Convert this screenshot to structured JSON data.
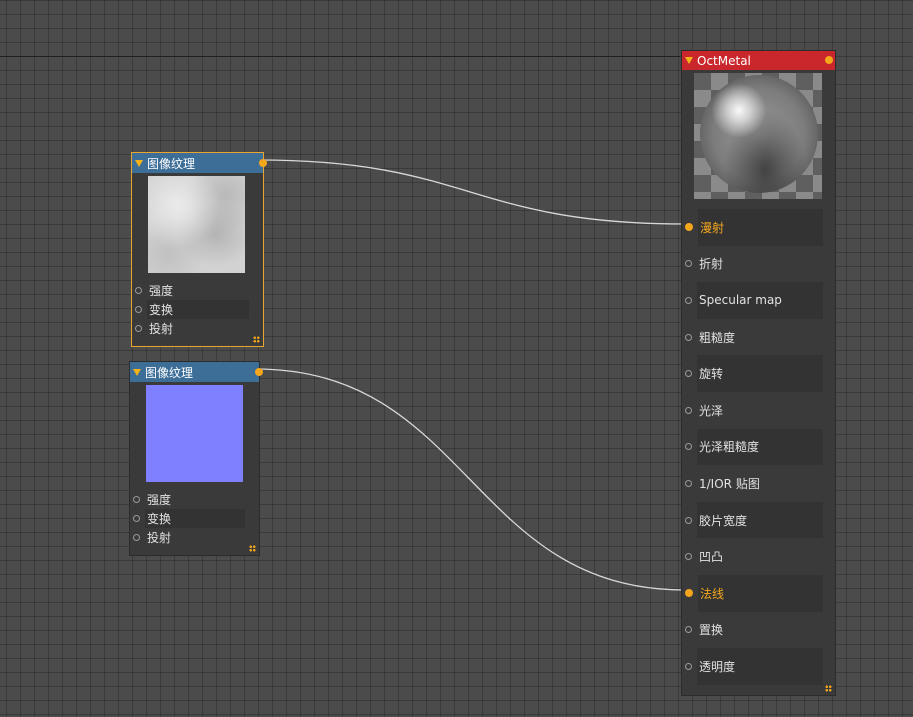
{
  "nodes": {
    "tex1": {
      "title": "图像纹理",
      "thumb_color": "#d8d8d8",
      "inputs": [
        "强度",
        "变换",
        "投射"
      ]
    },
    "tex2": {
      "title": "图像纹理",
      "thumb_color": "#7f80ff",
      "inputs": [
        "强度",
        "变换",
        "投射"
      ]
    },
    "octmetal": {
      "title": "OctMetal",
      "inputs": [
        {
          "label": "漫射",
          "connected": true
        },
        {
          "label": "折射",
          "connected": false
        },
        {
          "label": "Specular map",
          "connected": false
        },
        {
          "label": "粗糙度",
          "connected": false
        },
        {
          "label": "旋转",
          "connected": false
        },
        {
          "label": "光泽",
          "connected": false
        },
        {
          "label": "光泽粗糙度",
          "connected": false
        },
        {
          "label": "1/IOR 贴图",
          "connected": false
        },
        {
          "label": "胶片宽度",
          "connected": false
        },
        {
          "label": "凹凸",
          "connected": false
        },
        {
          "label": "法线",
          "connected": true
        },
        {
          "label": "置换",
          "connected": false
        },
        {
          "label": "透明度",
          "connected": false
        }
      ]
    }
  },
  "colors": {
    "background": "#4b4b4b",
    "texture_header": "#3c6e98",
    "material_header": "#c9272c",
    "accent": "#f4a71d",
    "selection": "#e9a531",
    "wire": "#d8d8d8"
  },
  "connections": [
    {
      "from": "tex1.output",
      "to": "octmetal.漫射"
    },
    {
      "from": "tex2.output",
      "to": "octmetal.法线"
    }
  ]
}
